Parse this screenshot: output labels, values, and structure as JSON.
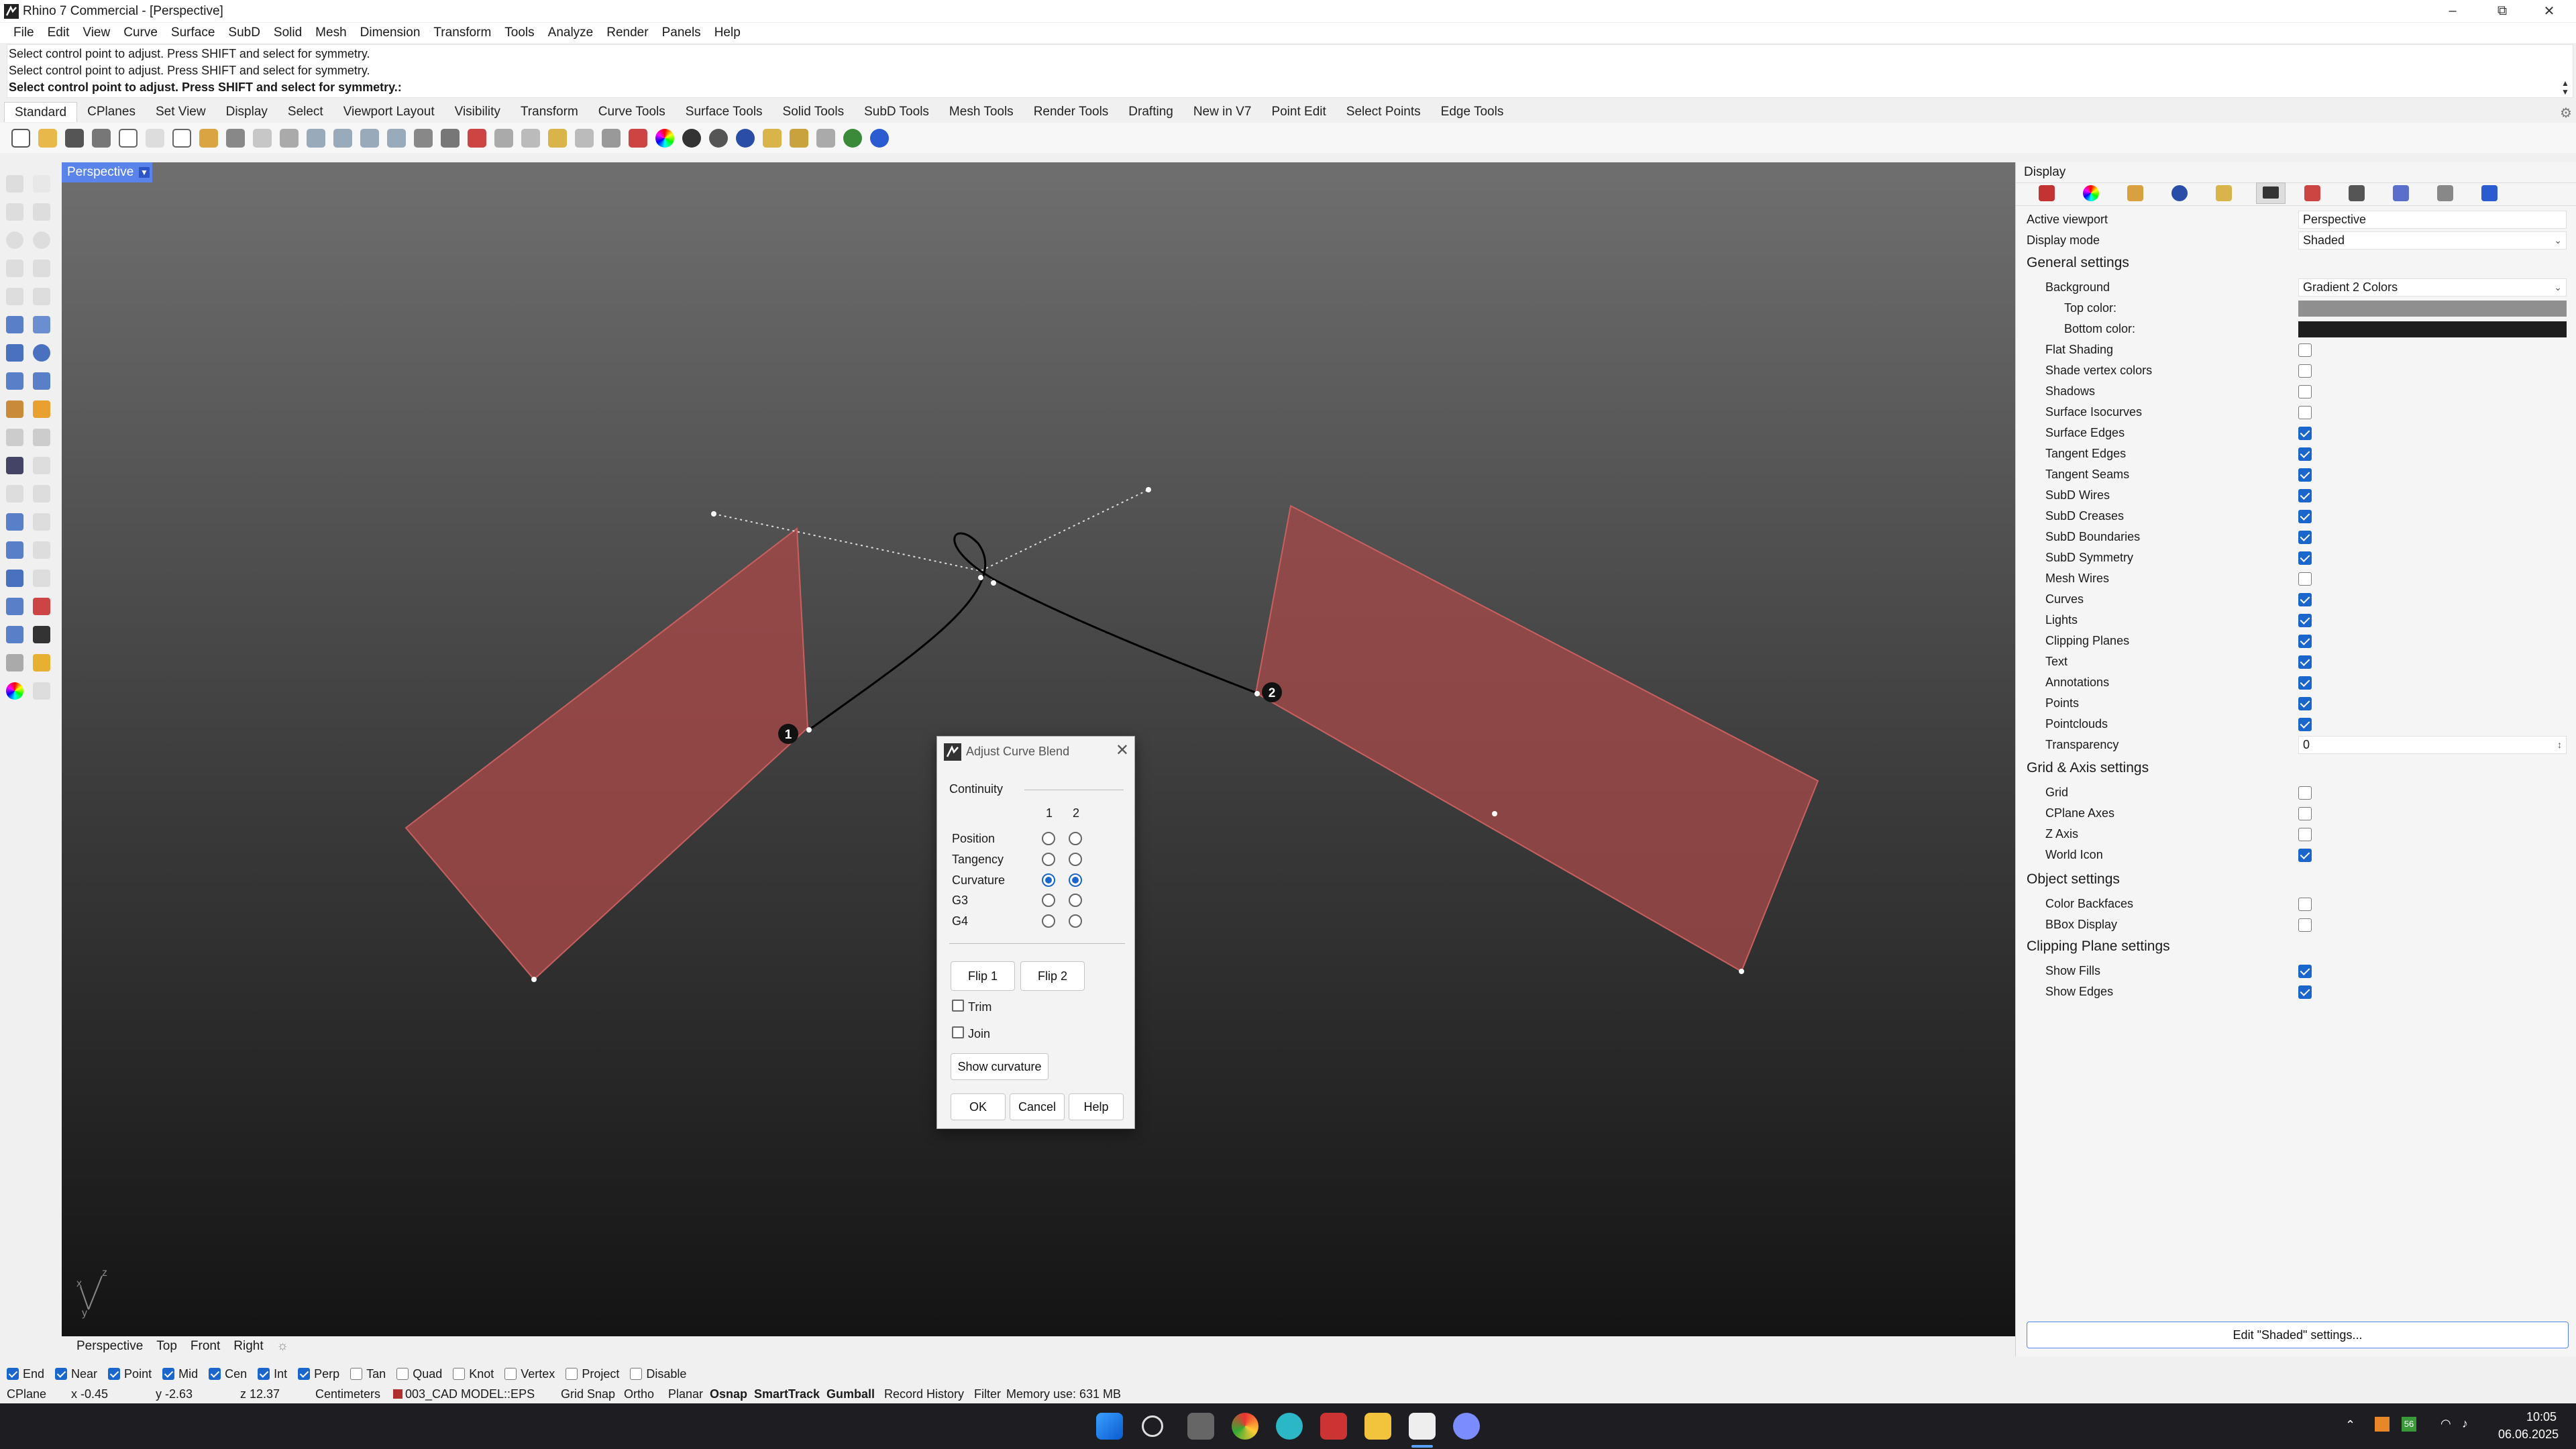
{
  "window": {
    "title": "Rhino 7 Commercial - [Perspective]"
  },
  "menu": [
    "File",
    "Edit",
    "View",
    "Curve",
    "Surface",
    "SubD",
    "Solid",
    "Mesh",
    "Dimension",
    "Transform",
    "Tools",
    "Analyze",
    "Render",
    "Panels",
    "Help"
  ],
  "command": {
    "history": [
      "Select control point to adjust. Press SHIFT and select for symmetry.",
      "Select control point to adjust. Press SHIFT and select for symmetry."
    ],
    "prompt": "Select control point to adjust. Press SHIFT and select for symmetry.:"
  },
  "toolbar_tabs": [
    "Standard",
    "CPlanes",
    "Set View",
    "Display",
    "Select",
    "Viewport Layout",
    "Visibility",
    "Transform",
    "Curve Tools",
    "Surface Tools",
    "Solid Tools",
    "SubD Tools",
    "Mesh Tools",
    "Render Tools",
    "Drafting",
    "New in V7",
    "Point Edit",
    "Select Points",
    "Edge Tools"
  ],
  "viewport": {
    "label": "Perspective",
    "axis_labels": {
      "x": "x",
      "y": "y",
      "z": "z"
    }
  },
  "markers": {
    "m1": "1",
    "m2": "2"
  },
  "dialog": {
    "title": "Adjust Curve Blend",
    "section": "Continuity",
    "col1": "1",
    "col2": "2",
    "rows": [
      "Position",
      "Tangency",
      "Curvature",
      "G3",
      "G4"
    ],
    "selected": {
      "end1": "Curvature",
      "end2": "Curvature"
    },
    "flip1": "Flip 1",
    "flip2": "Flip 2",
    "trim": "Trim",
    "join": "Join",
    "show_curvature": "Show curvature",
    "ok": "OK",
    "cancel": "Cancel",
    "help": "Help"
  },
  "panel": {
    "header": "Display",
    "active_viewport_label": "Active viewport",
    "active_viewport_value": "Perspective",
    "display_mode_label": "Display mode",
    "display_mode_value": "Shaded",
    "general_title": "General settings",
    "background_label": "Background",
    "background_value": "Gradient 2 Colors",
    "top_color_label": "Top color:",
    "top_color": "#8f8f8f",
    "bottom_color_label": "Bottom color:",
    "bottom_color": "#1e1e1e",
    "general_items": [
      {
        "label": "Flat Shading",
        "checked": false
      },
      {
        "label": "Shade vertex colors",
        "checked": false
      },
      {
        "label": "Shadows",
        "checked": false
      },
      {
        "label": "Surface Isocurves",
        "checked": false
      },
      {
        "label": "Surface Edges",
        "checked": true
      },
      {
        "label": "Tangent Edges",
        "checked": true
      },
      {
        "label": "Tangent Seams",
        "checked": true
      },
      {
        "label": "SubD Wires",
        "checked": true
      },
      {
        "label": "SubD Creases",
        "checked": true
      },
      {
        "label": "SubD Boundaries",
        "checked": true
      },
      {
        "label": "SubD Symmetry",
        "checked": true
      },
      {
        "label": "Mesh Wires",
        "checked": false
      },
      {
        "label": "Curves",
        "checked": true
      },
      {
        "label": "Lights",
        "checked": true
      },
      {
        "label": "Clipping Planes",
        "checked": true
      },
      {
        "label": "Text",
        "checked": true
      },
      {
        "label": "Annotations",
        "checked": true
      },
      {
        "label": "Points",
        "checked": true
      },
      {
        "label": "Pointclouds",
        "checked": true
      }
    ],
    "transparency_label": "Transparency",
    "transparency_value": "0",
    "grid_title": "Grid & Axis settings",
    "grid_items": [
      {
        "label": "Grid",
        "checked": false
      },
      {
        "label": "CPlane Axes",
        "checked": false
      },
      {
        "label": "Z Axis",
        "checked": false
      },
      {
        "label": "World Icon",
        "checked": true
      }
    ],
    "object_title": "Object settings",
    "object_items": [
      {
        "label": "Color Backfaces",
        "checked": false
      },
      {
        "label": "BBox Display",
        "checked": false
      }
    ],
    "clipping_title": "Clipping Plane settings",
    "clipping_items": [
      {
        "label": "Show Fills",
        "checked": true
      },
      {
        "label": "Show Edges",
        "checked": true
      }
    ],
    "edit_button": "Edit \"Shaded\" settings..."
  },
  "viewport_tabs": [
    "Perspective",
    "Top",
    "Front",
    "Right"
  ],
  "osnaps": [
    {
      "label": "End",
      "checked": true
    },
    {
      "label": "Near",
      "checked": true
    },
    {
      "label": "Point",
      "checked": true
    },
    {
      "label": "Mid",
      "checked": true
    },
    {
      "label": "Cen",
      "checked": true
    },
    {
      "label": "Int",
      "checked": true
    },
    {
      "label": "Perp",
      "checked": true
    },
    {
      "label": "Tan",
      "checked": false
    },
    {
      "label": "Quad",
      "checked": false
    },
    {
      "label": "Knot",
      "checked": false
    },
    {
      "label": "Vertex",
      "checked": false
    },
    {
      "label": "Project",
      "checked": false
    },
    {
      "label": "Disable",
      "checked": false
    }
  ],
  "status": {
    "cplane": "CPlane",
    "x": "x -0.45",
    "y": "y -2.63",
    "z": "z 12.37",
    "units": "Centimeters",
    "layer": "003_CAD MODEL::EPS",
    "grid_snap": "Grid Snap",
    "ortho": "Ortho",
    "planar": "Planar",
    "osnap": "Osnap",
    "smarttrack": "SmartTrack",
    "gumball": "Gumball",
    "record_history": "Record History",
    "filter": "Filter",
    "memory": "Memory use: 631 MB",
    "layer_color": "#b03030"
  },
  "taskbar": {
    "time": "10:05",
    "date": "06.06.2025",
    "badge": "56"
  },
  "colors": {
    "surface": "#a04848",
    "accent": "#1a66cc",
    "viewport_tab": "#5a84ea"
  }
}
